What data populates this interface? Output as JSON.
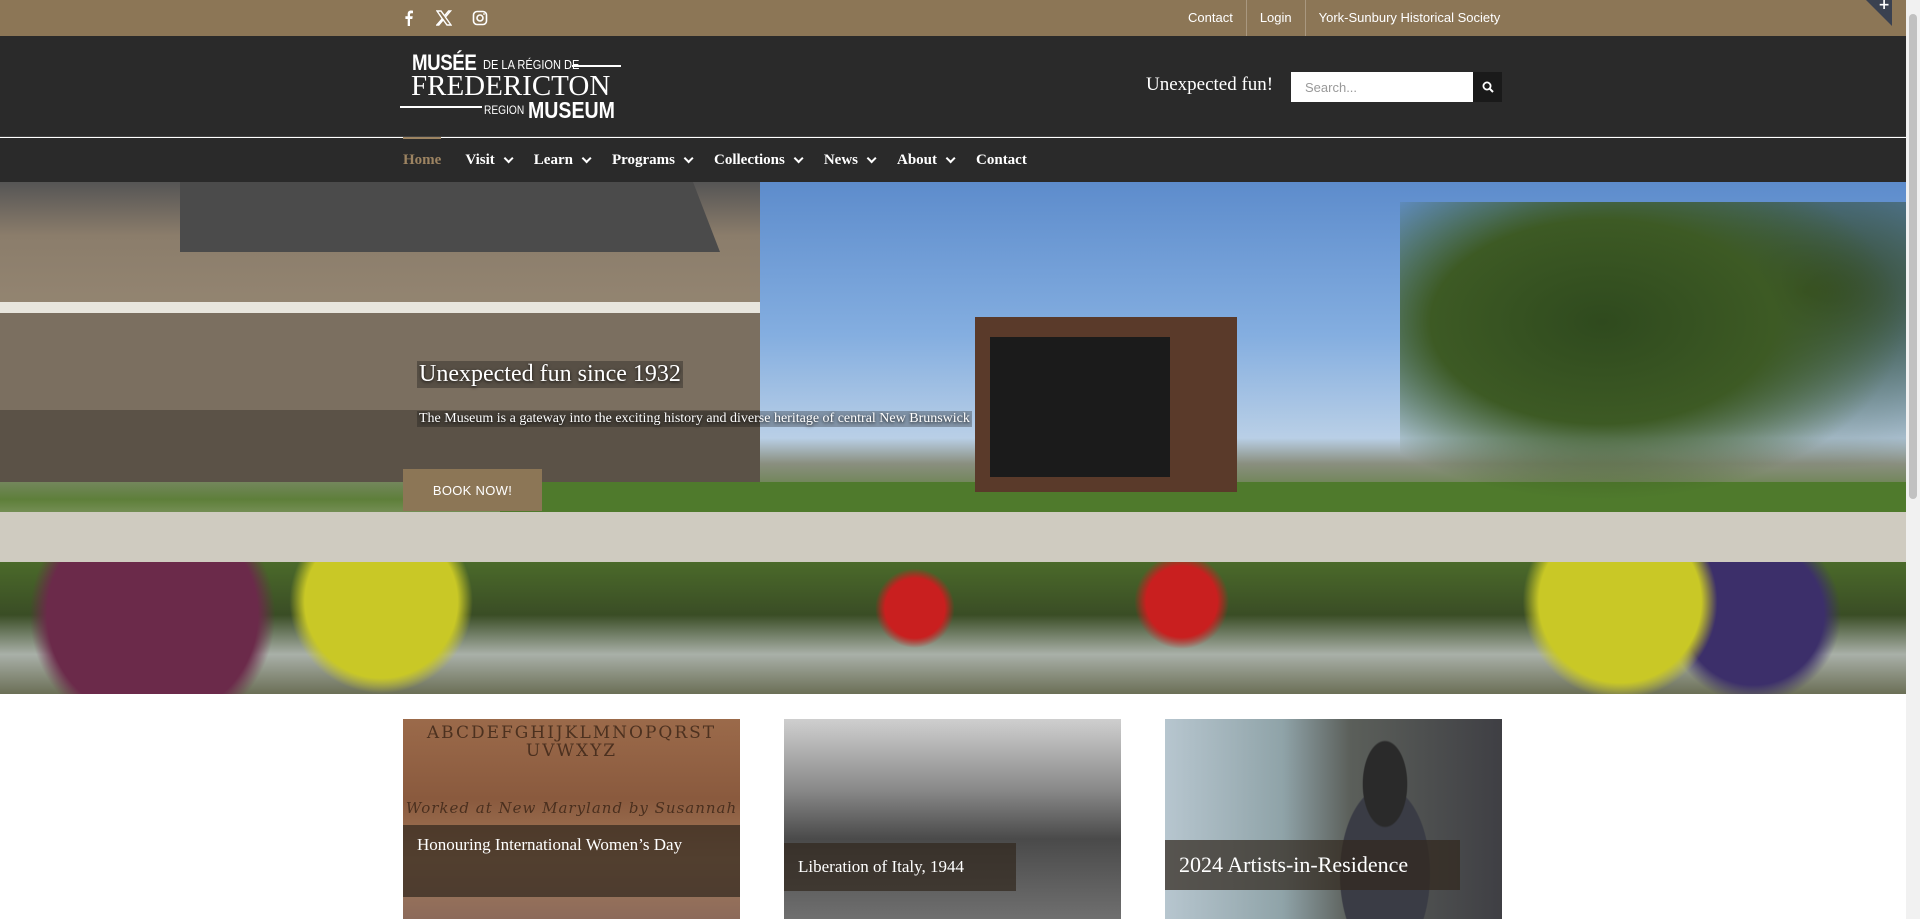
{
  "topbar": {
    "social": [
      "facebook-icon",
      "x-twitter-icon",
      "instagram-icon"
    ],
    "links": [
      "Contact",
      "Login",
      "York-Sunbury Historical Society"
    ]
  },
  "header": {
    "logo": {
      "line1": "MUSÉE",
      "line1b": "DE LA RÉGION DE",
      "line2": "FREDERICTON",
      "line3": "REGION",
      "line4": "MUSEUM"
    },
    "tagline": "Unexpected fun!",
    "search_placeholder": "Search..."
  },
  "nav": {
    "items": [
      {
        "label": "Home",
        "active": true,
        "dropdown": false
      },
      {
        "label": "Visit",
        "dropdown": true
      },
      {
        "label": "Learn",
        "dropdown": true
      },
      {
        "label": "Programs",
        "dropdown": true
      },
      {
        "label": "Collections",
        "dropdown": true
      },
      {
        "label": "News",
        "dropdown": true
      },
      {
        "label": "About",
        "dropdown": true
      },
      {
        "label": "Contact",
        "dropdown": false
      }
    ]
  },
  "hero": {
    "title": "Unexpected fun since 1932",
    "subtitle": "The Museum is a gateway into the exciting history and diverse heritage of central New Brunswick",
    "button": "BOOK NOW!"
  },
  "cards": [
    {
      "caption": "Honouring International Women’s Day"
    },
    {
      "caption": "Liberation of Italy, 1944"
    },
    {
      "caption": "2024 Artists-in-Residence"
    }
  ],
  "card1_stitching": [
    "ABCDEFGHIJKLMNOPQRST",
    "UVWXYZ",
    "Worked at New Maryland by Susannah"
  ],
  "colors": {
    "accent": "#8c7656",
    "header_bg": "#2a2a2a",
    "active_nav": "#9d8462"
  }
}
